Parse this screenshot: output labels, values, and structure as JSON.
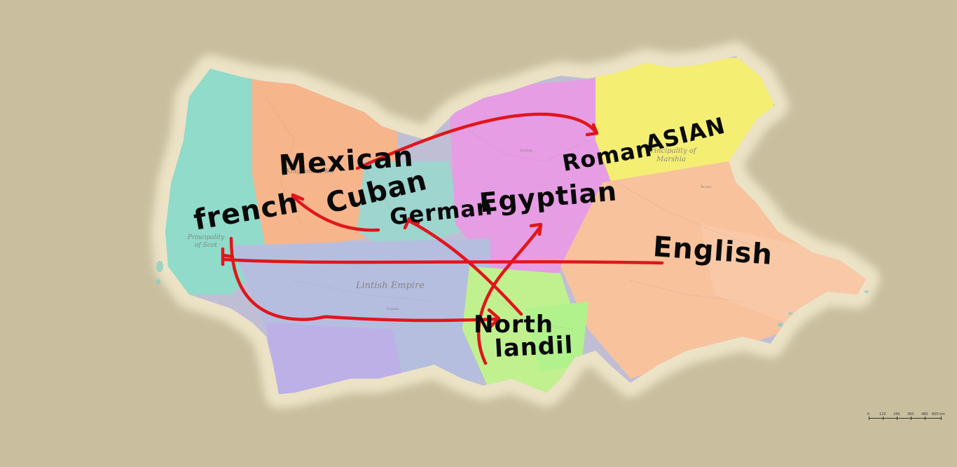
{
  "map": {
    "background_color": "#c9bf9f",
    "land_labels": {
      "realm_west_small": "Principality of Scot",
      "realm_north_small": "Kingdom of Kit",
      "realm_east_small": "Principality of Marshia",
      "empire": "Lintish Empire",
      "town_a": "Sedany",
      "town_b": "Eolena",
      "town_c": "Brune"
    },
    "annotations": {
      "french": "french",
      "mexican": "Mexican",
      "cuban": "Cuban",
      "german": "German",
      "egyptian": "Egyptian",
      "roman": "Roman",
      "asian": "ASIAN",
      "english": "English",
      "north": "North",
      "landil": "landil"
    },
    "arrow_color": "#e0161b",
    "ink_color": "#0a0a0a",
    "scale_bar": {
      "ticks": [
        "0",
        "120",
        "240",
        "360",
        "480",
        "600 km"
      ]
    }
  }
}
